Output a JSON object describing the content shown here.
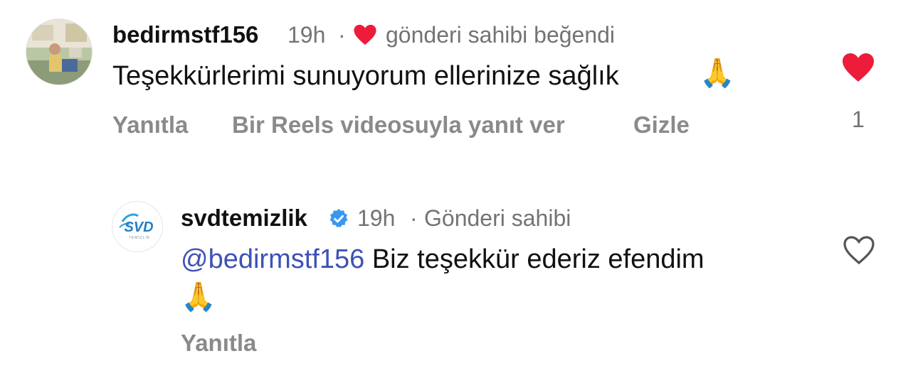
{
  "comments": [
    {
      "username": "bedirmstf156",
      "time": "19h",
      "separator": "·",
      "liked_by_author_label": "gönderi sahibi beğendi",
      "text": "Teşekkürlerimi sunuyorum ellerinize sağlık",
      "emoji": "🙏",
      "actions": {
        "reply": "Yanıtla",
        "reels_reply": "Bir Reels videosuyla yanıt ver",
        "hide": "Gizle"
      },
      "like_count": "1",
      "liked": true,
      "like_color": "#ed1c3a"
    },
    {
      "username": "svdtemizlik",
      "verified": true,
      "verified_color": "#3897f0",
      "time": "19h",
      "separator": "·",
      "author_label": "Gönderi sahibi",
      "mention": "@bedirmstf156",
      "text": "Biz teşekkür ederiz efendim",
      "emoji": "🙏",
      "actions": {
        "reply": "Yanıtla"
      },
      "liked": false,
      "avatar_logo_text": "SVD",
      "avatar_logo_subtext": "TEMİZLİK"
    }
  ]
}
